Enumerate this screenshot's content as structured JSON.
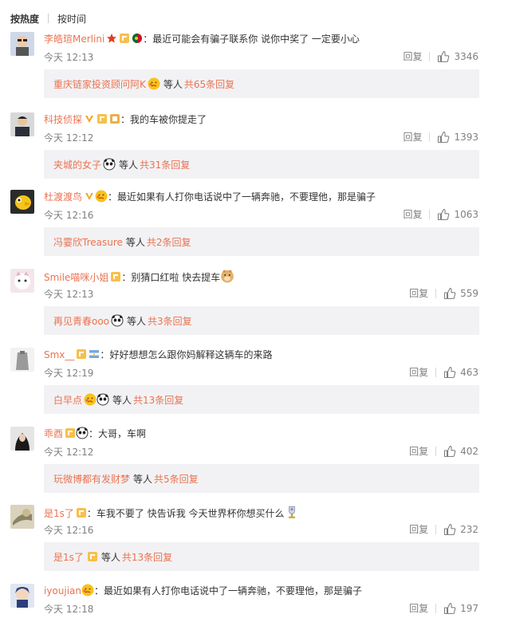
{
  "tabs": {
    "hot": "按热度",
    "time": "按时间"
  },
  "actions": {
    "reply": "回复"
  },
  "comments": [
    {
      "user": "李皓瑄Merlini",
      "badges": [
        "star",
        "gold",
        "flag-pt"
      ],
      "text": "最近可能会有骗子联系你 说你中奖了 一定要小心",
      "time": "今天 12:13",
      "likes": "3346",
      "replies": {
        "user": "重庆链家投资顾问阿K",
        "emoji": "cry",
        "mid": "等人",
        "count": "共65条回复"
      }
    },
    {
      "user": "科技侦探",
      "badges": [
        "v",
        "gold",
        "gold2"
      ],
      "text": "我的车被你提走了",
      "time": "今天 12:12",
      "likes": "1393",
      "replies": {
        "user": "夹城的女子",
        "emoji": "panda",
        "mid": "等人",
        "count": "共31条回复"
      }
    },
    {
      "user": "杜渡渡鸟",
      "badges": [
        "v",
        "cry"
      ],
      "text": "最近如果有人打你电话说中了一辆奔驰，不要理他，那是骗子",
      "time": "今天 12:16",
      "likes": "1063",
      "replies": {
        "user": "冯霎欣Treasure",
        "emoji": "",
        "mid": "等人",
        "count": "共2条回复"
      }
    },
    {
      "user": "Smile喵咪小姐",
      "badges": [
        "gold"
      ],
      "text": "别猜口红啦 快去提车",
      "trail": "doge",
      "time": "今天 12:13",
      "likes": "559",
      "replies": {
        "user": "再见青春ooo",
        "emoji": "panda",
        "mid": "等人",
        "count": "共3条回复"
      }
    },
    {
      "user": "Smx__",
      "badges": [
        "gold",
        "flag-ar"
      ],
      "text": "好好想想怎么跟你妈解释这辆车的来路",
      "time": "今天 12:19",
      "likes": "463",
      "replies": {
        "user": "白早点",
        "emoji": "cry-panda",
        "mid": "等人",
        "count": "共13条回复"
      }
    },
    {
      "user": "乖酉",
      "badges": [
        "gold",
        "panda"
      ],
      "text": "大哥，车啊",
      "time": "今天 12:12",
      "likes": "402",
      "replies": {
        "user": "玩微博都有发财梦",
        "emoji": "",
        "mid": "等人",
        "count": "共5条回复"
      }
    },
    {
      "user": "是1s了",
      "badges": [
        "gold"
      ],
      "text": "车我不要了 快告诉我 今天世界杯你想买什么",
      "trail": "trophy",
      "time": "今天 12:16",
      "likes": "232",
      "replies": {
        "user": "是1s了",
        "emoji": "gold",
        "mid": "等人",
        "count": "共13条回复"
      }
    },
    {
      "user": "iyoujian",
      "badges": [
        "cry"
      ],
      "text": "最近如果有人打你电话说中了一辆奔驰，不要理他，那是骗子",
      "time": "今天 12:18",
      "likes": "197",
      "replies": null
    }
  ],
  "colors": {
    "accent": "#eb7350",
    "muted": "#808080",
    "reply_bg": "#f2f2f5"
  }
}
